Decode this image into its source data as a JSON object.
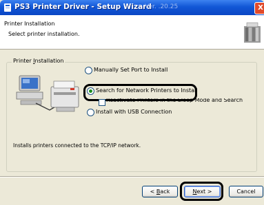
{
  "window": {
    "title": "PS3 Printer Driver - Setup Wizard",
    "title_blurred": "Ver. .20.25",
    "close_glyph": "X"
  },
  "header": {
    "title": "Printer Installation",
    "subtitle": "Select printer installation."
  },
  "group": {
    "label_pre": "Printer ",
    "label_mnemonic": "I",
    "label_post": "nstallation"
  },
  "options": {
    "manual": {
      "label": "Manually Set Port to Install",
      "selected": false
    },
    "search": {
      "label": "Search for Network Printers to Install",
      "selected": true
    },
    "reactivate": {
      "label": "Reactivate Printers in the Sleep Mode and Search",
      "checked": false
    },
    "usb": {
      "label": "Install with USB Connection",
      "selected": false
    }
  },
  "description": "Installs printers connected to the TCP/IP network.",
  "buttons": {
    "back_pre": "< ",
    "back_mnemonic": "B",
    "back_post": "ack",
    "next_mnemonic": "N",
    "next_post": "ext >",
    "cancel": "Cancel"
  }
}
